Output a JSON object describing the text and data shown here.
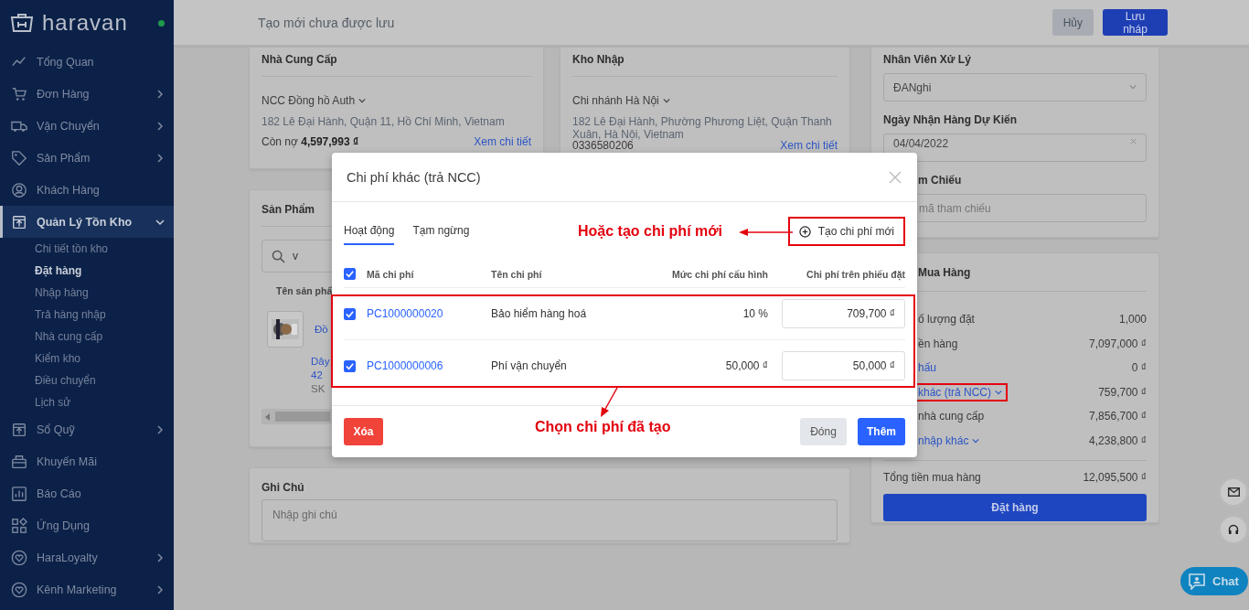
{
  "sidebar": {
    "logo": "haravan",
    "items": [
      {
        "label": "Tổng Quan"
      },
      {
        "label": "Đơn Hàng",
        "expanded": false
      },
      {
        "label": "Vận Chuyển",
        "expanded": false
      },
      {
        "label": "Sản Phẩm",
        "expanded": false
      },
      {
        "label": "Khách Hàng"
      },
      {
        "label": "Quản Lý Tồn Kho",
        "expanded": true,
        "selected": true,
        "children": [
          {
            "label": "Chi tiết tồn kho",
            "selected": false
          },
          {
            "label": "Đặt hàng",
            "selected": true
          },
          {
            "label": "Nhập hàng",
            "selected": false
          },
          {
            "label": "Trả hàng nhập",
            "selected": false
          },
          {
            "label": "Nhà cung cấp",
            "selected": false
          },
          {
            "label": "Kiểm kho",
            "selected": false
          },
          {
            "label": "Điều chuyển",
            "selected": false
          },
          {
            "label": "Lịch sử",
            "selected": false
          }
        ]
      },
      {
        "label": "Sổ Quỹ",
        "expanded": false
      },
      {
        "label": "Khuyến Mãi"
      },
      {
        "label": "Báo Cáo"
      },
      {
        "label": "Ứng Dụng"
      },
      {
        "label": "HaraLoyalty",
        "expanded": false
      },
      {
        "label": "Kênh Marketing",
        "expanded": false
      }
    ]
  },
  "topbar": {
    "title": "Tạo mới chưa được lưu",
    "cancel": "Hủy",
    "save": "Lưu nháp"
  },
  "supplier": {
    "title": "Nhà Cung Cấp",
    "selector": "NCC Đồng hồ Auth",
    "address": "182 Lê Đại Hành, Quận 11, Hồ Chí Minh, Vietnam",
    "debt_label": "Còn nợ",
    "debt": "4,597,993 ₫",
    "link": "Xem chi tiết"
  },
  "warehouse": {
    "title": "Kho Nhập",
    "selector": "Chi nhánh Hà Nội",
    "address": "182 Lê Đại Hành, Phường Phương Liệt, Quận Thanh Xuân, Hà Nội, Vietnam",
    "phone": "0336580206",
    "link": "Xem chi tiết"
  },
  "products": {
    "title": "Sản Phẩm",
    "search": "v",
    "column": "Tên sản phẩ",
    "name": "Đồ",
    "variant": [
      "Dây",
      "42"
    ],
    "sku": "SK"
  },
  "notes": {
    "title": "Ghi Chú",
    "placeholder": "Nhập ghi chú"
  },
  "details": {
    "staff_label": "Nhân Viên Xử Lý",
    "staff": "ĐANghi",
    "date_label": "Ngày Nhận Hàng Dự Kiến",
    "date": "04/04/2022",
    "ref_label": "m Chiếu",
    "ref_placeholder": "mã tham chiếu"
  },
  "summary": {
    "title": "Mua Hàng",
    "rows": [
      {
        "kind": "plain",
        "label": "ố lượng đặt",
        "value": "1,000",
        "highlighted": false
      },
      {
        "kind": "plain",
        "label": "ền hàng",
        "value": "7,097,000 ₫",
        "highlighted": false
      },
      {
        "kind": "link",
        "label": "hấu",
        "value": "0 ₫",
        "highlighted": false
      },
      {
        "kind": "dropdown",
        "label": "khác (trả NCC)",
        "value": "759,700 ₫",
        "highlighted": true
      },
      {
        "kind": "plain",
        "label": "nhà cung cấp",
        "value": "7,856,700 ₫",
        "highlighted": false
      },
      {
        "kind": "dropdown",
        "label": "nhập khác",
        "value": "4,238,800 ₫",
        "highlighted": false
      }
    ],
    "total_label": "Tổng tiền mua hàng",
    "total": "12,095,500 ₫",
    "order_button": "Đặt hàng"
  },
  "modal": {
    "title": "Chi phí khác (trả NCC)",
    "tabs": [
      {
        "label": "Hoạt động",
        "selected": true
      },
      {
        "label": "Tạm ngừng",
        "selected": false
      }
    ],
    "create_button": "Tạo chi phí mới",
    "select_all": true,
    "columns": [
      "Mã chi phí",
      "Tên chi phí",
      "Mức chi phí cấu hình",
      "Chi phí trên phiếu đặt"
    ],
    "rows": [
      {
        "checked": true,
        "code": "PC1000000020",
        "name": "Bảo hiểm hàng hoá",
        "config": "10 %",
        "amount": "709,700 ₫"
      },
      {
        "checked": true,
        "code": "PC1000000006",
        "name": "Phí vận chuyển",
        "config": "50,000 ₫",
        "amount": "50,000 ₫"
      }
    ],
    "delete": "Xóa",
    "close": "Đóng",
    "add": "Thêm"
  },
  "annotations": [
    "Hoặc tạo chi phí mới",
    "Chọn chi phí đã tạo"
  ],
  "chat": "Chat"
}
